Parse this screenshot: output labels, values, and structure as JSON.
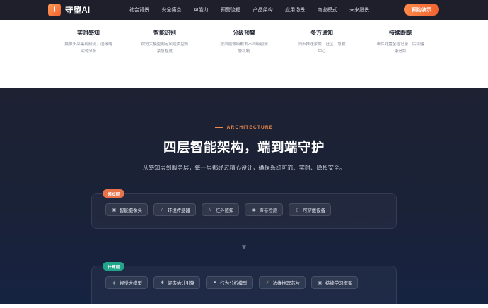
{
  "nav": {
    "brand": "守望AI",
    "links": [
      "社会背景",
      "安全痛点",
      "AI能力",
      "预警流程",
      "产品架构",
      "应用场景",
      "商业模式",
      "未来愿景"
    ],
    "cta": "预约演示"
  },
  "features": [
    {
      "title": "实时感知",
      "desc1": "摄像头采集视频流，边缘端",
      "desc2": "实时分析"
    },
    {
      "title": "智能识别",
      "desc1": "视觉大模型判定风险类型与",
      "desc2": "紧急程度"
    },
    {
      "title": "分级预警",
      "desc1": "按风险等级触发不同级别预",
      "desc2": "警机制"
    },
    {
      "title": "多方通知",
      "desc1": "同步推送家属、社区、急救",
      "desc2": "中心"
    },
    {
      "title": "持续跟踪",
      "desc1": "事件处置全程记录，后续健",
      "desc2": "康追踪"
    }
  ],
  "architecture": {
    "eyebrow": "ARCHITECTURE",
    "title": "四层智能架构，端到端守护",
    "subtitle": "从感知层到服务层，每一层都经过精心设计，确保系统可靠、实时、隐私安全。",
    "layers": [
      {
        "tag": "感知层",
        "color": "#e8724a",
        "chips": [
          {
            "icon": "camera-icon",
            "glyph": "📷",
            "label": "智能摄像头"
          },
          {
            "icon": "sensor-icon",
            "glyph": "⸝",
            "label": "环境传感器"
          },
          {
            "icon": "infrared-icon",
            "glyph": "∕",
            "label": "红外感知"
          },
          {
            "icon": "sound-icon",
            "glyph": "◉",
            "label": "声音检测"
          },
          {
            "icon": "wearable-icon",
            "glyph": "▯",
            "label": "可穿戴设备"
          }
        ]
      },
      {
        "tag": "计算层",
        "color": "#22a58a",
        "chips": [
          {
            "icon": "brain-icon",
            "glyph": "◈",
            "label": "视觉大模型"
          },
          {
            "icon": "pose-icon",
            "glyph": "✱",
            "label": "姿态估计引擎"
          },
          {
            "icon": "behavior-icon",
            "glyph": "●",
            "label": "行为分析模型"
          },
          {
            "icon": "lightning-icon",
            "glyph": "⚡",
            "label": "边缘推理芯片"
          },
          {
            "icon": "framework-icon",
            "glyph": "▣",
            "label": "持续学习框架"
          }
        ]
      }
    ],
    "arrow": "⬇"
  }
}
